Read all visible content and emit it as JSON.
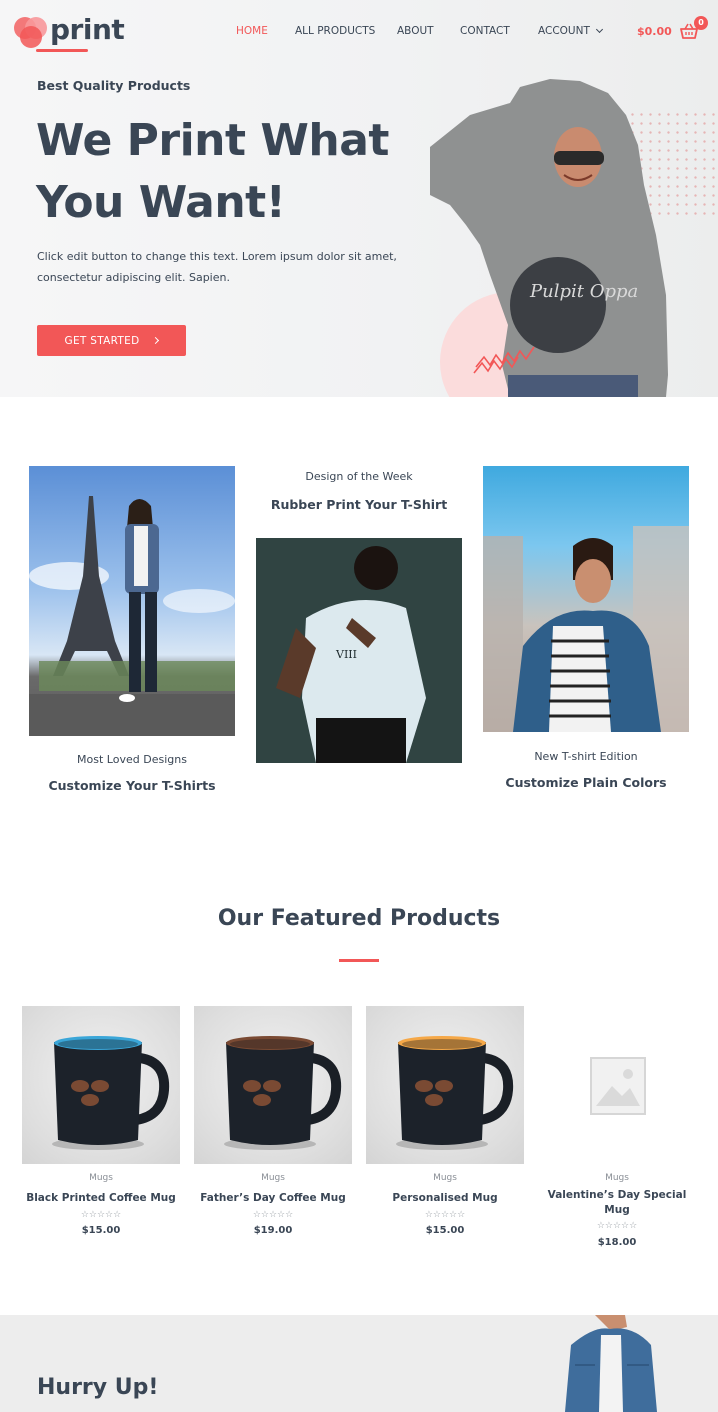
{
  "header": {
    "logo_text": "print",
    "nav": [
      "HOME",
      "ALL PRODUCTS",
      "ABOUT",
      "CONTACT",
      "ACCOUNT"
    ],
    "cart_amount": "$0.00",
    "cart_count": "0"
  },
  "hero": {
    "subtitle": "Best Quality Products",
    "title_line1": "We Print What",
    "title_line2": "You Want!",
    "text": "Click edit button to change this text. Lorem ipsum dolor sit amet, consectetur adipiscing elit. Sapien.",
    "button_label": "GET STARTED",
    "shirt_text": "Pulpit Oppa"
  },
  "designs": [
    {
      "caption": "Most Loved Designs",
      "title": "Customize Your T-Shirts"
    },
    {
      "caption": "Design of the Week",
      "title": "Rubber Print Your T-Shirt",
      "shirt_text": "VIII"
    },
    {
      "caption": "New T-shirt Edition",
      "title": "Customize Plain Colors"
    }
  ],
  "featured": {
    "title": "Our Featured Products",
    "products": [
      {
        "category": "Mugs",
        "name": "Black Printed Coffee Mug",
        "price": "$15.00",
        "rating": 0,
        "rim_color": "#3aa6d8"
      },
      {
        "category": "Mugs",
        "name": "Father’s Day Coffee Mug",
        "price": "$19.00",
        "rating": 0,
        "rim_color": "#7a4a33"
      },
      {
        "category": "Mugs",
        "name": "Personalised Mug",
        "price": "$15.00",
        "rating": 0,
        "rim_color": "#f5a848"
      },
      {
        "category": "Mugs",
        "name": "Valentine’s Day Special Mug",
        "price": "$18.00",
        "rating": 0,
        "rim_color": ""
      }
    ]
  },
  "hurry": {
    "title": "Hurry Up!"
  },
  "colors": {
    "accent": "#f25757",
    "text": "#3a4655"
  }
}
